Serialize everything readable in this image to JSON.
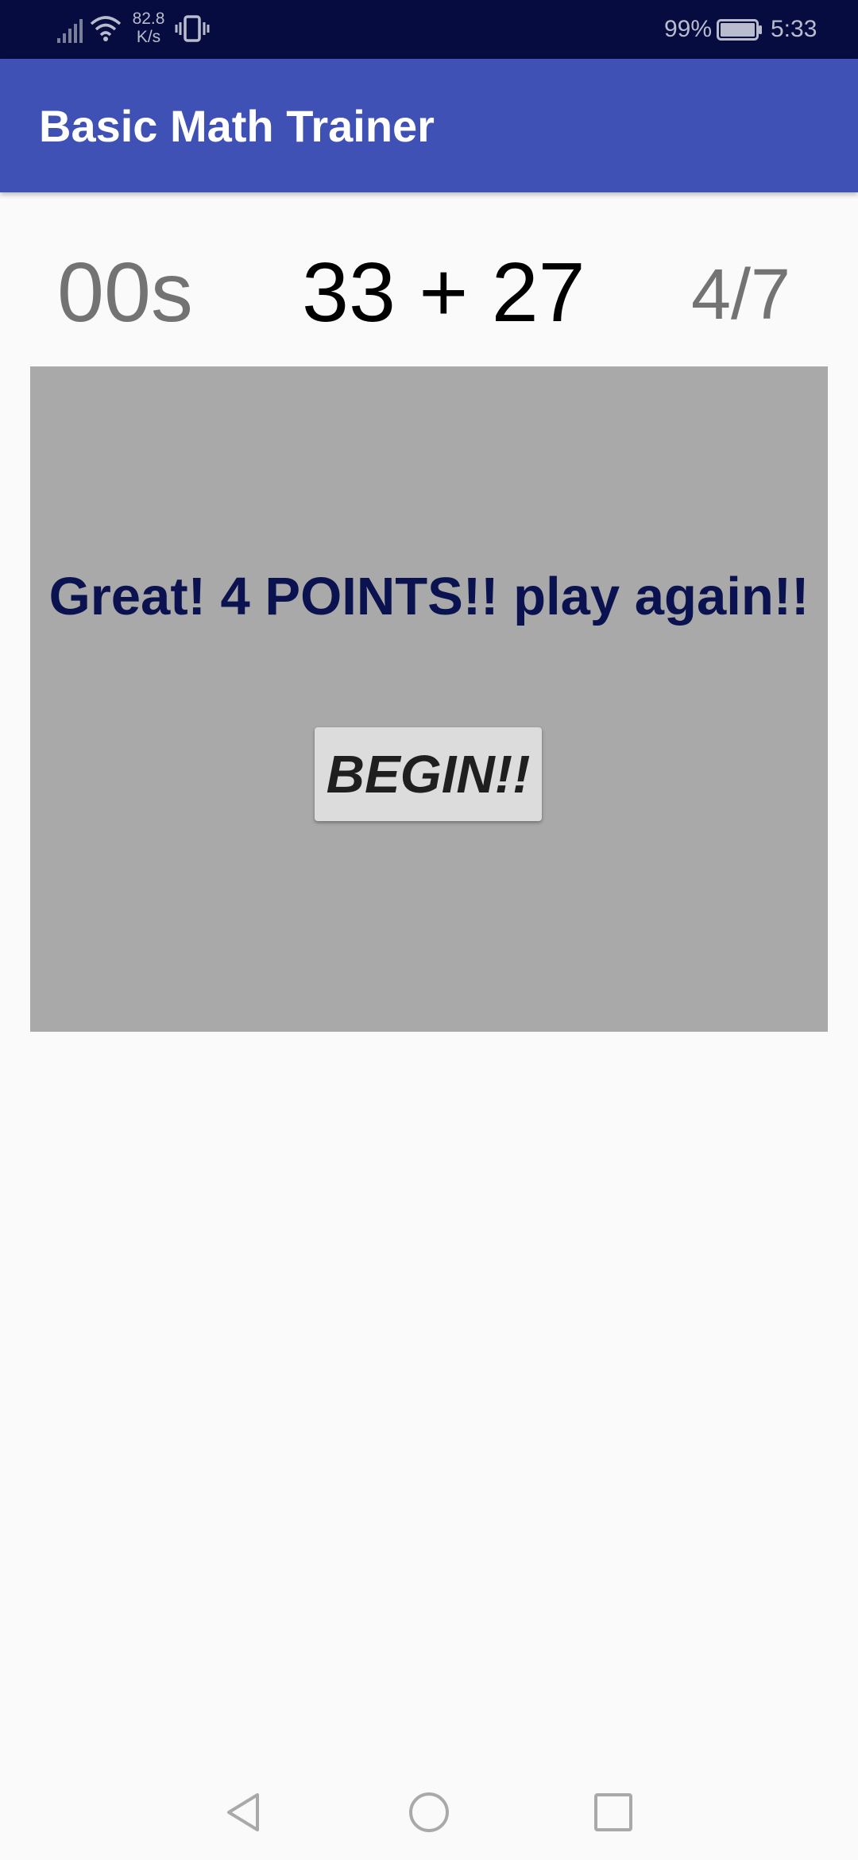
{
  "status_bar": {
    "network_speed_value": "82.8",
    "network_speed_unit": "K/s",
    "battery_percent": "99%",
    "time": "5:33",
    "icons": [
      "signal-icon",
      "wifi-icon",
      "vibrate-icon",
      "battery-icon"
    ]
  },
  "app_bar": {
    "title": "Basic Math Trainer",
    "color": "#3f51b5"
  },
  "game": {
    "timer": "00s",
    "question": "33 + 27",
    "score": "4/7",
    "result_message": "Great! 4 POINTS!! play again!!",
    "begin_label": "BEGIN!!"
  },
  "nav_bar": {
    "icons": [
      "back-icon",
      "home-icon",
      "recent-apps-icon"
    ]
  },
  "colors": {
    "status_bar_bg": "#060c40",
    "panel_bg": "#a9a9a9",
    "result_text": "#0a1250",
    "page_bg": "#fafafa"
  }
}
